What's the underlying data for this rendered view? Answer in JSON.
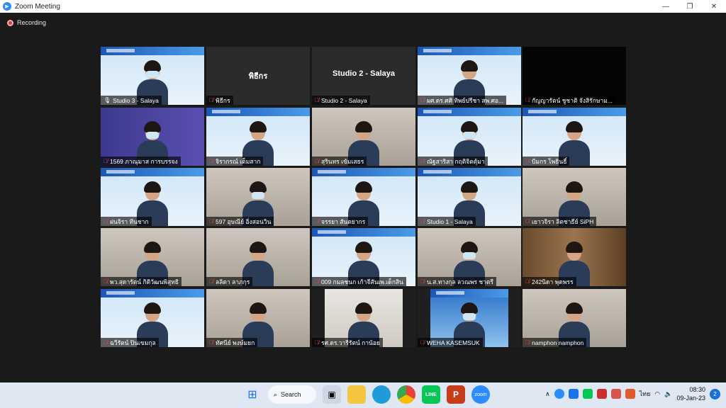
{
  "window": {
    "title": "Zoom Meeting",
    "minimize": "—",
    "maximize": "❐",
    "close": "✕"
  },
  "meeting": {
    "recording_label": "Recording"
  },
  "tiles": [
    {
      "name": "Studio 3 - Salaya",
      "center": "",
      "bg": "slide",
      "muted": false
    },
    {
      "name": "พิธีกร",
      "center": "พิธีกร",
      "bg": "dark",
      "muted": true
    },
    {
      "name": "Studio 2 - Salaya",
      "center": "Studio 2 - Salaya",
      "bg": "dark",
      "muted": true
    },
    {
      "name": "ผศ.ดร.ศศิ ทิพย์ปรีชา สพ.ศอ...",
      "center": "",
      "bg": "slide",
      "muted": true
    },
    {
      "name": "กัญญารัตน์ ชูชาติ จังสิรักษาม...",
      "center": "",
      "bg": "black",
      "muted": true
    },
    {
      "name": "1569 ภาณุมาส การบรรจง",
      "center": "",
      "bg": "mdc",
      "muted": true
    },
    {
      "name": "จิรากรณ์ เต็มสาก",
      "center": "",
      "bg": "slide",
      "muted": true
    },
    {
      "name": "สุรินทร เข้มเสธร",
      "center": "",
      "bg": "room",
      "muted": true
    },
    {
      "name": "ณัฐสาริสา กฤติจิตตุ้มา",
      "center": "",
      "bg": "slide",
      "muted": true
    },
    {
      "name": "บีมกร โพธินธิ์",
      "center": "",
      "bg": "slide",
      "muted": true
    },
    {
      "name": "ฝนจิรา ทีนชาก",
      "center": "",
      "bg": "slide",
      "muted": true
    },
    {
      "name": "597 อุษณีย์ อิ่งสอนวิน",
      "center": "",
      "bg": "room",
      "muted": true
    },
    {
      "name": "จรรยา สันตยากร",
      "center": "",
      "bg": "slide",
      "muted": true
    },
    {
      "name": "Studio 1 - Salaya",
      "center": "",
      "bg": "slide",
      "muted": true
    },
    {
      "name": "เยาวจิรา ลิตชาธีย์ SiPH",
      "center": "",
      "bg": "room",
      "muted": true
    },
    {
      "name": "พว.สุดารัตน์ กิติวัฒนพิสุทธิ",
      "center": "",
      "bg": "room",
      "muted": true
    },
    {
      "name": "ลลิตา ลาภกุร",
      "center": "",
      "bg": "room",
      "muted": true
    },
    {
      "name": "009 กมลชนก เก้าจีสันเพ.เด็กสิน",
      "center": "",
      "bg": "slide",
      "muted": true
    },
    {
      "name": "น.ส.ทางกุล ลวณพร ชาตรี",
      "center": "",
      "bg": "room",
      "muted": true
    },
    {
      "name": "242นิดา พุดพรร",
      "center": "",
      "bg": "wood",
      "muted": true
    },
    {
      "name": "ฉวีรัตน์ ปินเขมกุล",
      "center": "",
      "bg": "slide",
      "muted": true
    },
    {
      "name": "ทัศนีย์ พงษ์มยก",
      "center": "",
      "bg": "room",
      "muted": true
    },
    {
      "name": "รศ.ดร.วารีรัตน์ กาน้อย",
      "center": "",
      "bg": "lab",
      "muted": true
    },
    {
      "name": "WEHA KASEMSUK",
      "center": "",
      "bg": "blueslide",
      "muted": true
    },
    {
      "name": "namphon namphon",
      "center": "",
      "bg": "room",
      "muted": true
    }
  ],
  "taskbar": {
    "search_label": "Search",
    "input_lang": "ไทย",
    "time": "08:30",
    "date": "09-Jan-23",
    "notification_count": "2"
  },
  "colors": {
    "active_speaker": "#c8e03a",
    "zoom_blue": "#2d8cff",
    "muted_red": "#e05050"
  }
}
